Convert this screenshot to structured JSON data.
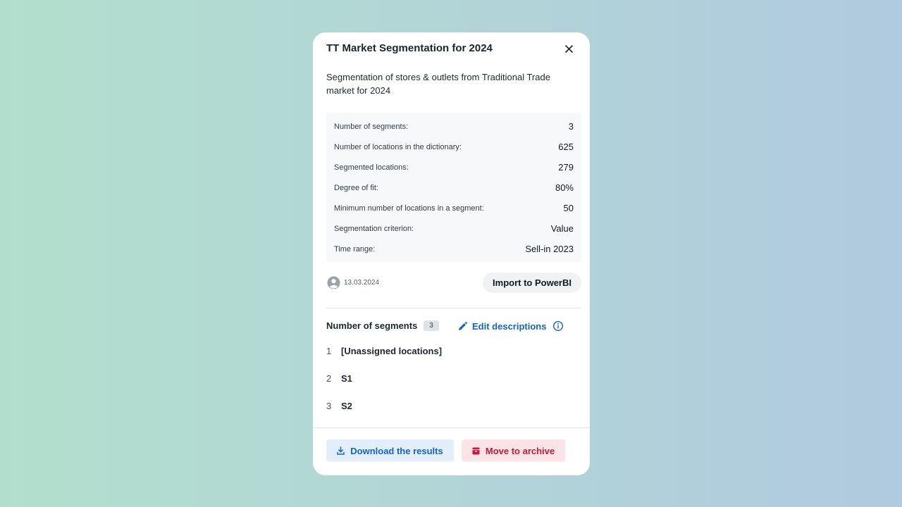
{
  "modal": {
    "title": "TT Market Segmentation for 2024",
    "description": "Segmentation of stores & outlets from Traditional Trade market for 2024",
    "close_icon": "close-icon"
  },
  "stats": [
    {
      "label": "Number of segments:",
      "value": "3"
    },
    {
      "label": "Number of locations in the dictionary:",
      "value": "625"
    },
    {
      "label": "Segmented locations:",
      "value": "279"
    },
    {
      "label": "Degree of fit:",
      "value": "80%"
    },
    {
      "label": "Minimum number of locations in a segment:",
      "value": "50"
    },
    {
      "label": "Segmentation criterion:",
      "value": "Value"
    },
    {
      "label": "Time range:",
      "value": "Sell-in 2023"
    }
  ],
  "meta": {
    "date": "13.03.2024",
    "avatar_icon": "user-icon",
    "import_label": "Import to PowerBI"
  },
  "segments": {
    "title": "Number of segments",
    "count": "3",
    "edit_label": "Edit descriptions",
    "items": [
      {
        "num": "1",
        "name": "[Unassigned locations]"
      },
      {
        "num": "2",
        "name": "S1"
      },
      {
        "num": "3",
        "name": "S2"
      }
    ]
  },
  "footer": {
    "download_label": "Download the results",
    "archive_label": "Move to archive"
  },
  "colors": {
    "accent_blue": "#1463c9",
    "danger_red": "#c21a3a"
  }
}
